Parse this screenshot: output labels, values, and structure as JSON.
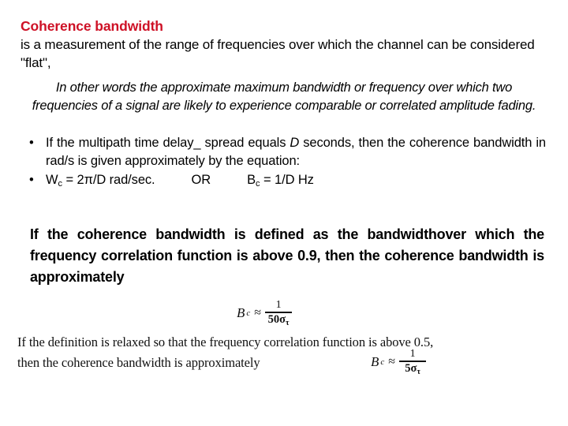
{
  "slide": {
    "title": "Coherence bandwidth",
    "intro": "is a measurement of the range of frequencies over which the channel can be considered \"flat\",",
    "italic_note": "In other words the approximate maximum bandwidth or frequency over which two frequencies of a signal are likely to experience comparable or correlated amplitude fading.",
    "bullets": [
      {
        "marker": "•",
        "text_before_var": "If the multipath time delay_ spread equals ",
        "variable": "D",
        "text_after_var": " seconds, then the coherence bandwidth in rad/s is given approximately by the equation:"
      },
      {
        "marker": "•",
        "lhs_symbol": "W",
        "lhs_subscript": "c",
        "lhs_expression": " = 2π/D rad/sec.",
        "connector": "OR",
        "rhs_symbol": "B",
        "rhs_subscript": "c",
        "rhs_expression": " = 1/D Hz"
      }
    ],
    "paragraph": "If the coherence bandwidth is defined as the bandwidthover which the frequency correlation function is above 0.9, then the coherence bandwidth is approximately",
    "scan": {
      "formula_top": {
        "lhs": "B",
        "lhs_sub": "c",
        "relation": "≈",
        "numerator": "1",
        "denominator": "50σ",
        "denominator_sub": "τ"
      },
      "line1": "If the definition is relaxed so that the frequency correlation function is above 0.5,",
      "line2": "then the coherence bandwidth is approximately",
      "formula_bottom": {
        "lhs": "B",
        "lhs_sub": "c",
        "relation": "≈",
        "numerator": "1",
        "denominator": "5σ",
        "denominator_sub": "τ"
      }
    }
  },
  "colors": {
    "title_red": "#CE1126",
    "body_black": "#000000",
    "background": "#FFFFFF"
  }
}
